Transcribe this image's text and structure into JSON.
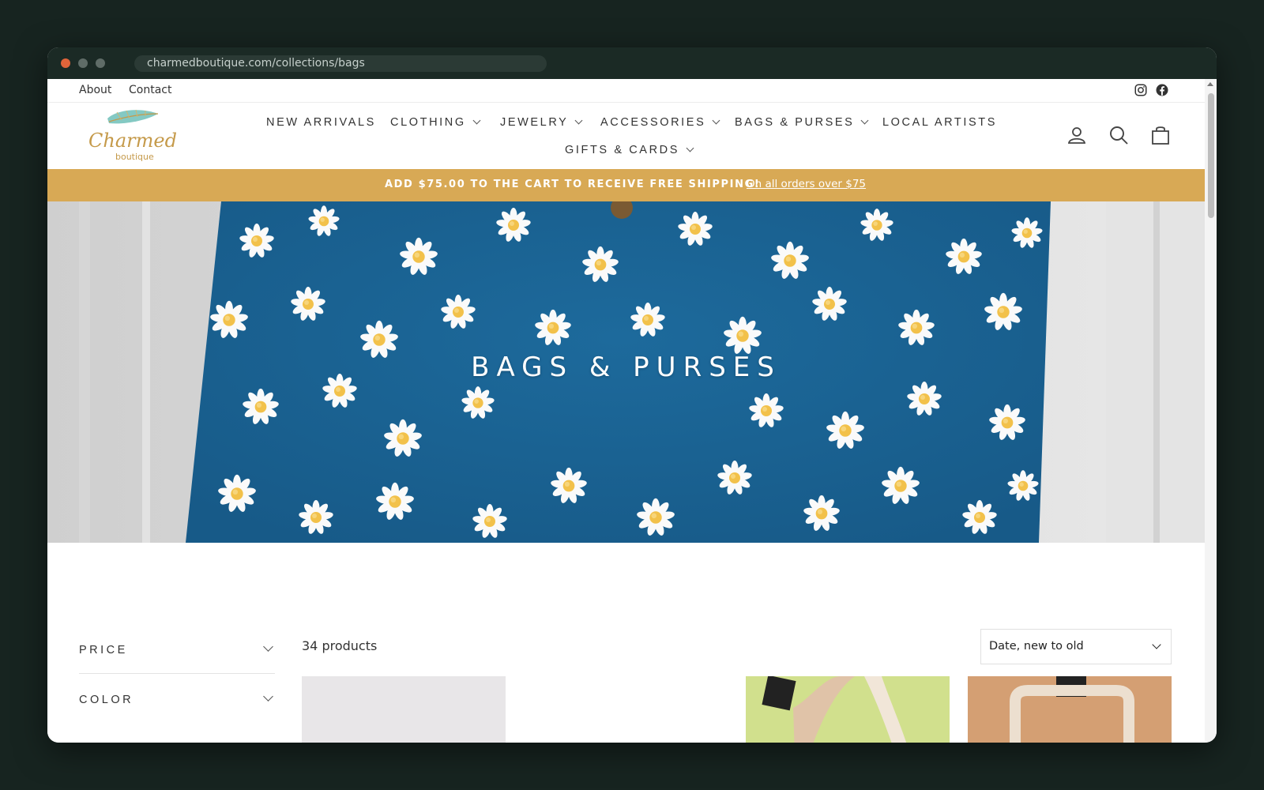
{
  "browser": {
    "url": "charmedboutique.com/collections/bags"
  },
  "utility_bar": {
    "about": "About",
    "contact": "Contact",
    "social": [
      "instagram-icon",
      "facebook-icon"
    ]
  },
  "logo": {
    "line1": "Charmed",
    "line2": "boutique"
  },
  "nav": {
    "new_arrivals": "NEW ARRIVALS",
    "clothing": "CLOTHING",
    "jewelry": "JEWELRY",
    "accessories": "ACCESSORIES",
    "bags_purses": "BAGS & PURSES",
    "local_artists": "LOCAL ARTISTS",
    "gifts_cards": "GIFTS & CARDS"
  },
  "header_icons": [
    "account-icon",
    "search-icon",
    "cart-icon"
  ],
  "announcement": {
    "text": "ADD $75.00 TO THE CART TO RECEIVE FREE SHIPPING!",
    "link": "On all orders over $75"
  },
  "hero": {
    "title": "BAGS & PURSES"
  },
  "filters": {
    "price": "PRICE",
    "color": "COLOR"
  },
  "collection": {
    "count": "34 products",
    "sort_value": "Date, new to old"
  },
  "colors": {
    "accent": "#d8a955",
    "hero_fabric": "#1f6ea0",
    "titlebar": "#1b2a25"
  }
}
